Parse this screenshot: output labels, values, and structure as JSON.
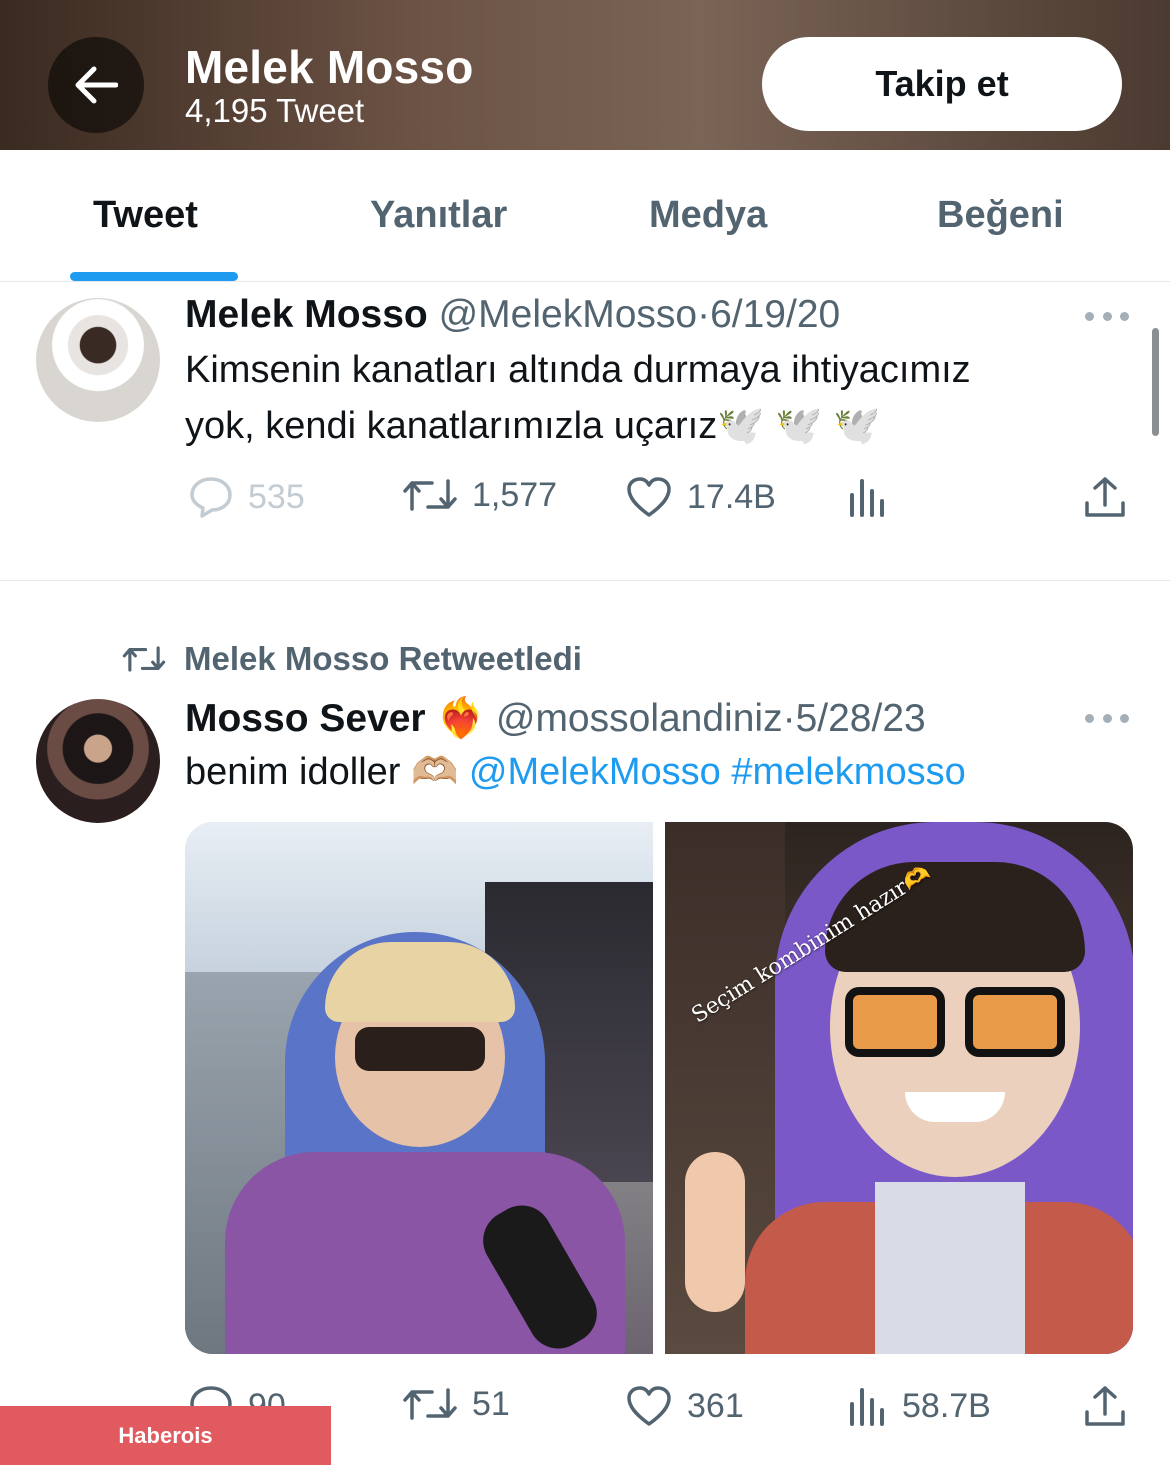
{
  "header": {
    "name": "Melek Mosso",
    "tweet_count": "4,195 Tweet",
    "follow_label": "Takip et"
  },
  "tabs": [
    {
      "label": "Tweet",
      "active": true
    },
    {
      "label": "Yanıtlar",
      "active": false
    },
    {
      "label": "Medya",
      "active": false
    },
    {
      "label": "Beğeni",
      "active": false
    }
  ],
  "tweets": [
    {
      "name": "Melek Mosso",
      "handle": "@MelekMosso",
      "sep": "·",
      "date": "6/19/20",
      "line1": "Kimsenin kanatları altında durmaya ihtiyacımız",
      "line2": "yok, kendi kanatlarımızla uçarız🕊️ 🕊️ 🕊️",
      "replies": "535",
      "retweets": "1,577",
      "likes": "17.4B"
    },
    {
      "retweet_label": "Melek Mosso Retweetledi",
      "name": "Mosso Sever",
      "emoji": "❤️‍🔥",
      "handle": "@mossolandiniz",
      "sep": "·",
      "date": "5/28/23",
      "text_main": "benim idoller 🫶🏼 ",
      "mention": "@MelekMosso",
      "hashtag": "#melekmosso",
      "story_caption": "Seçim kombinim hazır🫶",
      "replies": "90",
      "retweets": "51",
      "likes": "361",
      "views": "58.7B"
    }
  ],
  "watermark": "Haberois",
  "colors": {
    "accent": "#1d9bf0",
    "secondary_text": "#536471",
    "watermark_bg": "#e05a5f"
  }
}
